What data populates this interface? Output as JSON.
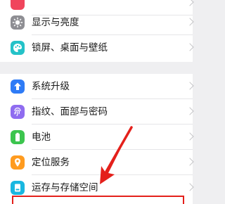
{
  "settings": {
    "items": [
      {
        "label": "",
        "icon": "app-icon",
        "color": "#f0455c"
      },
      {
        "label": "显示与亮度",
        "icon": "display-brightness-icon",
        "color": "#8e8e93"
      },
      {
        "label": "锁屏、桌面与壁纸",
        "icon": "wallpaper-palette-icon",
        "color": "#24c2c8"
      },
      {
        "label": "系统升级",
        "icon": "system-update-icon",
        "color": "#2e7bf6"
      },
      {
        "label": "指纹、面部与密码",
        "icon": "fingerprint-icon",
        "color": "#8f6cf0"
      },
      {
        "label": "电池",
        "icon": "battery-icon",
        "color": "#3cc54e"
      },
      {
        "label": "定位服务",
        "icon": "location-icon",
        "color": "#ff9b1f"
      },
      {
        "label": "运存与存储空间",
        "icon": "storage-icon",
        "color": "#19b7e0"
      }
    ]
  },
  "annotation": {
    "arrow_color": "#e4201b",
    "highlight_color": "#e4201b"
  }
}
